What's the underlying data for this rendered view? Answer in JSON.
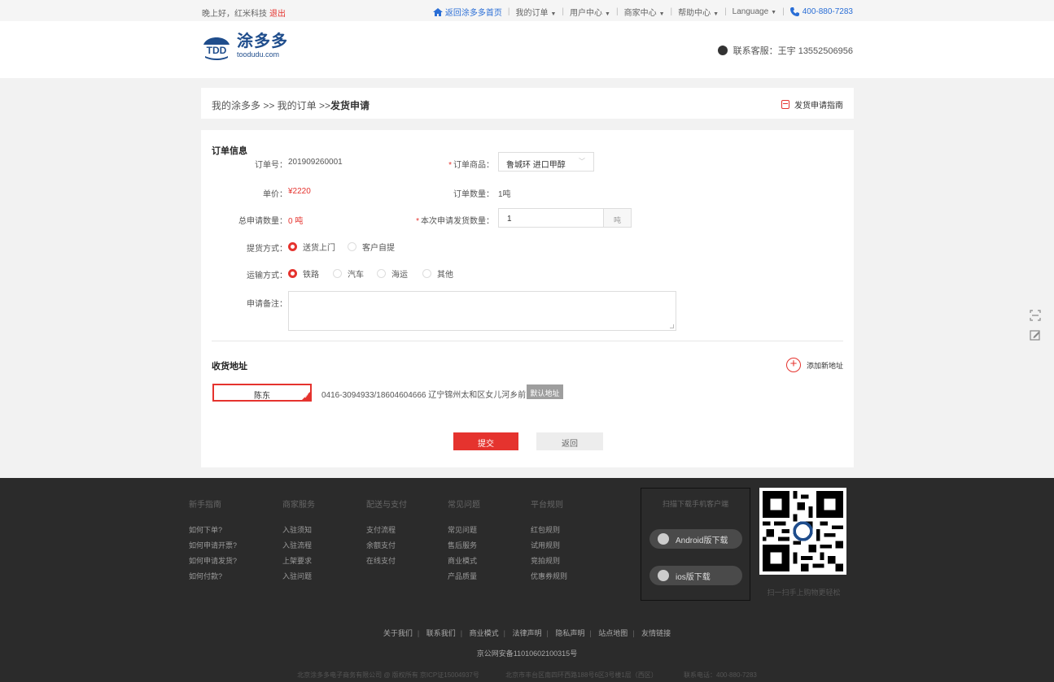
{
  "topbar": {
    "greeting": "晚上好，红米科技",
    "logout": "退出",
    "home_link": "返回涂多多首页",
    "menus": [
      "我的订单",
      "用户中心",
      "商家中心",
      "帮助中心",
      "Language"
    ],
    "phone": "400-880-7283"
  },
  "header": {
    "logo_cn": "涂多多",
    "logo_en": "toodudu.com",
    "logo_mark": "TDD",
    "service_label": "联系客服：",
    "service_contact": "王宇 13552506956"
  },
  "breadcrumb": {
    "path": "我的涂多多 >> 我的订单 >>",
    "current": "发货申请",
    "guide": "发货申请指南"
  },
  "order": {
    "section_title": "订单信息",
    "order_no_label": "订单号：",
    "order_no": "201909260001",
    "product_label": "订单商品：",
    "product_value": "鲁城环 进口甲醇",
    "price_label": "单价：",
    "price": "¥2220",
    "quantity_label": "订单数量：",
    "quantity": "1吨",
    "total_apply_label": "总申请数量：",
    "total_apply": "0 吨",
    "this_apply_label": "本次申请发货数量：",
    "this_apply_value": "1",
    "this_apply_unit": "吨",
    "pickup_label": "提货方式：",
    "pickup_options": [
      "送货上门",
      "客户自提"
    ],
    "pickup_selected": 0,
    "transport_label": "运输方式：",
    "transport_options": [
      "铁路",
      "汽车",
      "海运",
      "其他"
    ],
    "transport_selected": 0,
    "remark_label": "申请备注："
  },
  "address": {
    "section_title": "收货地址",
    "add_new": "添加新地址",
    "name": "陈东",
    "info": "0416-3094933/18604604666   辽宁锦州太和区女儿河乡前白村",
    "default_tag": "默认地址"
  },
  "actions": {
    "submit": "提交",
    "back": "返回"
  },
  "footer": {
    "columns": [
      {
        "title": "新手指南",
        "links": [
          "如何下单?",
          "如何申请开票?",
          "如何申请发货?",
          "如何付款?"
        ]
      },
      {
        "title": "商家服务",
        "links": [
          "入驻须知",
          "入驻流程",
          "上架要求",
          "入驻问题"
        ]
      },
      {
        "title": "配送与支付",
        "links": [
          "支付流程",
          "余额支付",
          "在线支付"
        ]
      },
      {
        "title": "常见问题",
        "links": [
          "常见问题",
          "售后服务",
          "商业模式",
          "产品质量"
        ]
      },
      {
        "title": "平台规则",
        "links": [
          "红包规则",
          "试用规则",
          "竞拍规则",
          "优惠券规则"
        ]
      }
    ],
    "app_title": "扫描下载手机客户端",
    "android": "Android版下载",
    "ios": "ios版下载",
    "qr_caption": "扫一扫手上购物更轻松",
    "links": [
      "关于我们",
      "联系我们",
      "商业模式",
      "法律声明",
      "隐私声明",
      "站点地图",
      "友情链接"
    ],
    "icp": "京公网安备11010602100315号",
    "copyright": "北京涂多多电子商务有限公司 @ 版权所有 京ICP证15004937号",
    "address": "北京市丰台区南四环西路188号6区3号楼1层（西区）",
    "phone": "联系电话：400-880-7283"
  }
}
